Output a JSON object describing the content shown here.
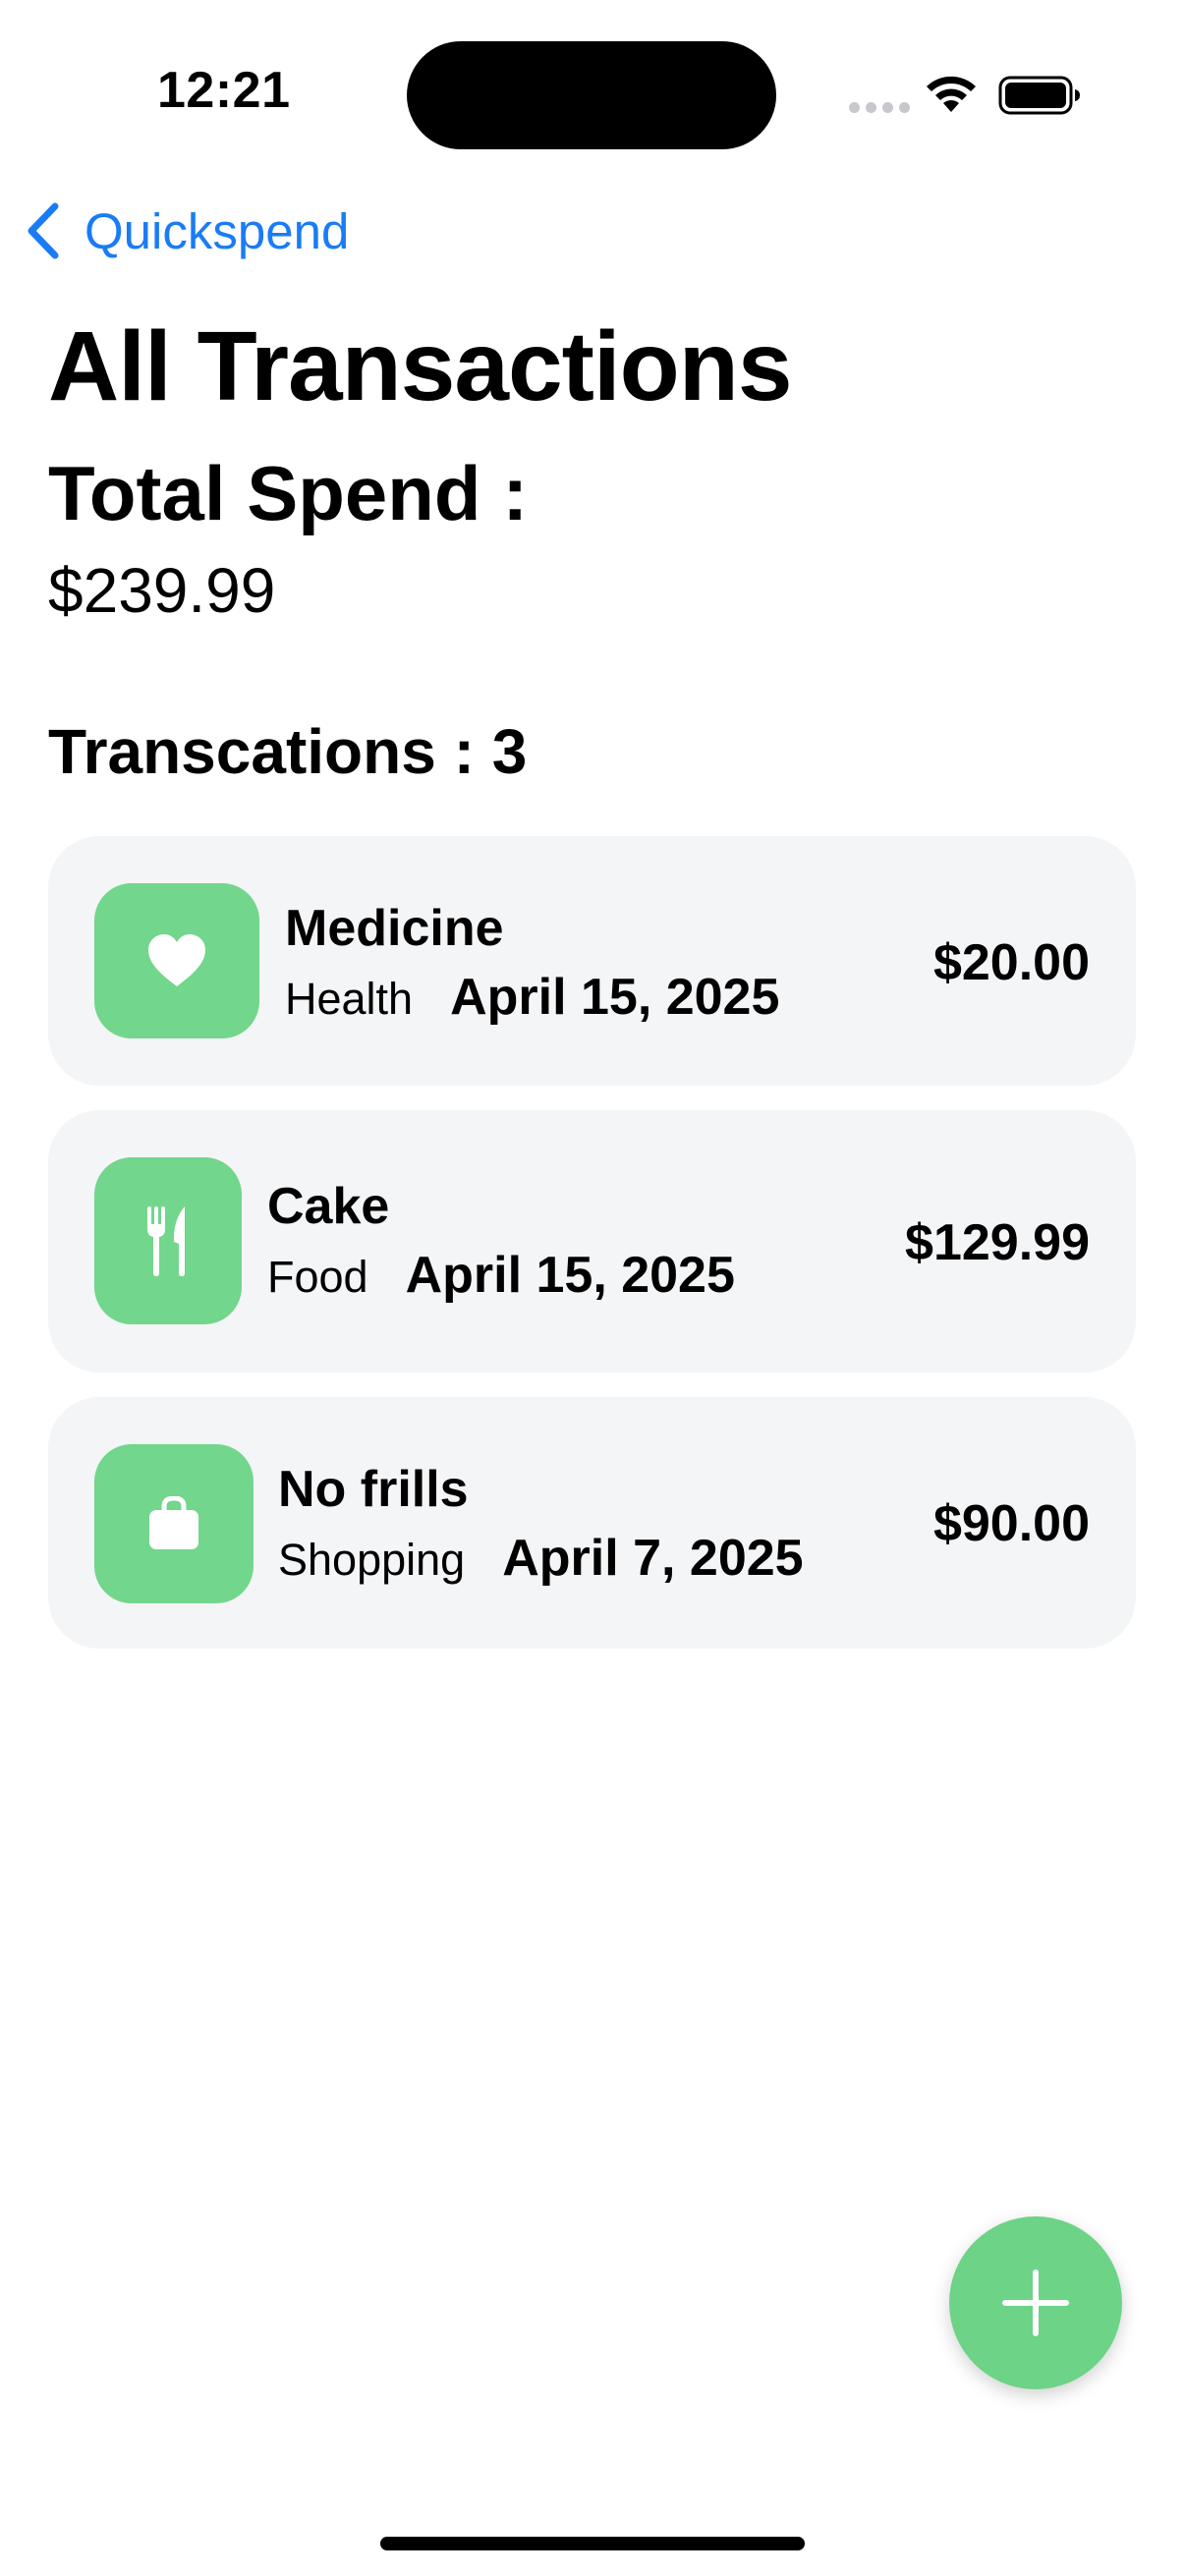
{
  "status_bar": {
    "time": "12:21"
  },
  "nav": {
    "back_label": "Quickspend"
  },
  "page": {
    "title": "All Transactions",
    "total_label": "Total Spend :",
    "total_value": "$239.99",
    "count_heading": "Transcations : 3"
  },
  "transactions": [
    {
      "title": "Medicine",
      "category": "Health",
      "date": "April 15, 2025",
      "amount": "$20.00",
      "icon": "heart-icon"
    },
    {
      "title": "Cake",
      "category": "Food",
      "date": "April 15, 2025",
      "amount": "$129.99",
      "icon": "fork-knife-icon"
    },
    {
      "title": "No frills",
      "category": "Shopping",
      "date": "April 7, 2025",
      "amount": "$90.00",
      "icon": "shopping-bag-icon"
    }
  ],
  "fab": {
    "icon": "plus-icon"
  },
  "colors": {
    "accent_green": "#72d68c",
    "link_blue": "#1a7cf5",
    "card_background": "#f4f5f7"
  }
}
